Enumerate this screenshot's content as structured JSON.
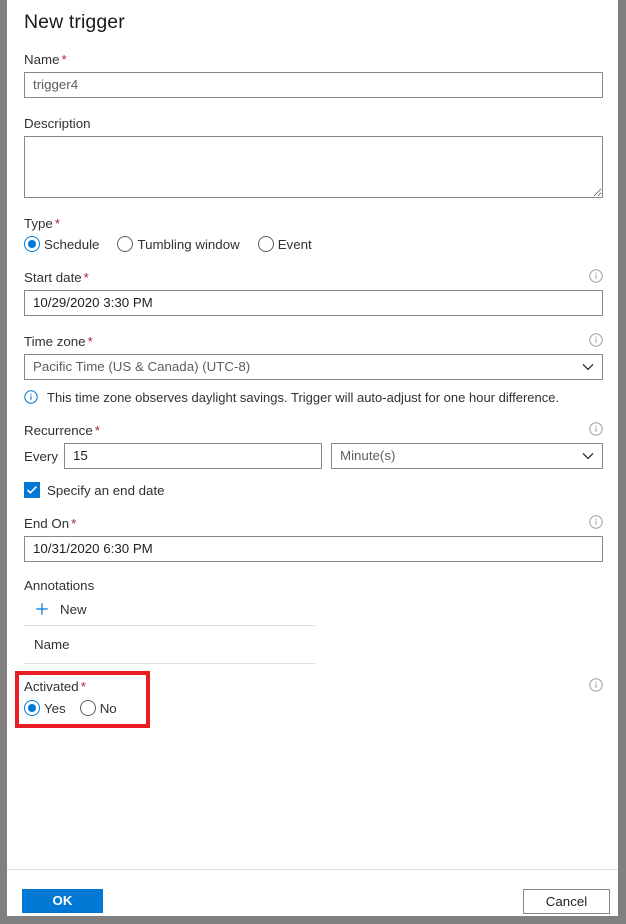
{
  "dialog": {
    "title": "New trigger"
  },
  "name_field": {
    "label": "Name",
    "required": "*",
    "value": "trigger4"
  },
  "description_field": {
    "label": "Description",
    "value": "",
    "placeholder": ""
  },
  "type_field": {
    "label": "Type",
    "required": "*",
    "options": [
      {
        "label": "Schedule",
        "selected": true
      },
      {
        "label": "Tumbling window",
        "selected": false
      },
      {
        "label": "Event",
        "selected": false
      }
    ]
  },
  "start_date_field": {
    "label": "Start date",
    "required": "*",
    "value": "10/29/2020 3:30 PM",
    "info_icon": "info-icon"
  },
  "time_zone_field": {
    "label": "Time zone",
    "required": "*",
    "value": "Pacific Time (US & Canada) (UTC-8)",
    "info_icon": "info-icon",
    "chevron_icon": "chevron-down-icon"
  },
  "time_zone_message": {
    "icon": "info-icon",
    "text": "This time zone observes daylight savings. Trigger will auto-adjust for one hour difference."
  },
  "recurrence_field": {
    "label": "Recurrence",
    "required": "*",
    "info_icon": "info-icon",
    "every_label": "Every",
    "value": "15",
    "unit": "Minute(s)",
    "chevron_icon": "chevron-down-icon"
  },
  "end_date_checkbox": {
    "label": "Specify an end date",
    "checked": true,
    "check_icon": "checkmark-icon"
  },
  "end_on_field": {
    "label": "End On",
    "required": "*",
    "value": "10/31/2020 6:30 PM",
    "info_icon": "info-icon"
  },
  "annotations": {
    "label": "Annotations",
    "new_label": "New",
    "plus_icon": "plus-icon",
    "column_header": "Name",
    "rows": []
  },
  "activated_field": {
    "label": "Activated",
    "required": "*",
    "info_icon": "info-icon",
    "options": [
      {
        "label": "Yes",
        "selected": true
      },
      {
        "label": "No",
        "selected": false
      }
    ],
    "highlight_color": "#ec1c24"
  },
  "footer": {
    "ok_label": "OK",
    "cancel_label": "Cancel"
  },
  "theme": {
    "accent": "#0078d4",
    "required_asterisk": "#a4262c",
    "border": "#8a8886",
    "text": "#323130",
    "frame": "#808080"
  }
}
